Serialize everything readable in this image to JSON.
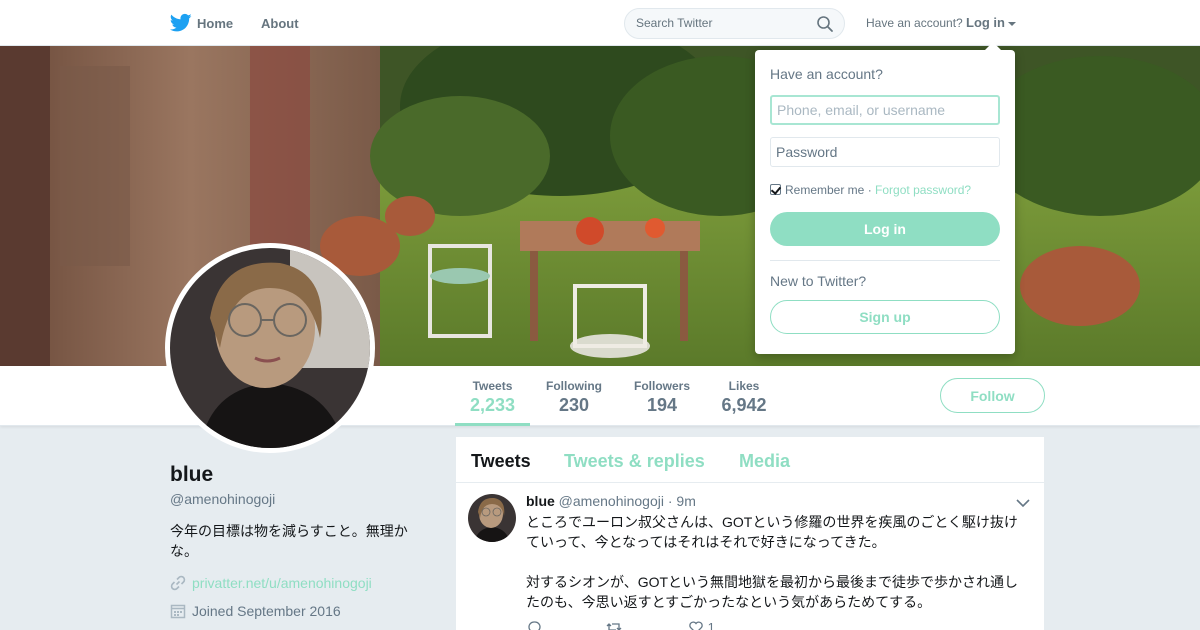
{
  "nav": {
    "logo_icon": "twitter-bird-icon",
    "home_label": "Home",
    "about_label": "About",
    "search_placeholder": "Search Twitter",
    "search_icon": "search-icon",
    "have_account_label": "Have an account?",
    "login_label": "Log in"
  },
  "profile": {
    "name": "blue",
    "handle": "@amenohinogoji",
    "bio": "今年の目標は物を減らすこと。無理かな。",
    "link": "privatter.net/u/amenohinogoji",
    "joined": "Joined September 2016"
  },
  "stats": {
    "tweets_label": "Tweets",
    "tweets_value": "2,233",
    "following_label": "Following",
    "following_value": "230",
    "followers_label": "Followers",
    "followers_value": "194",
    "likes_label": "Likes",
    "likes_value": "6,942"
  },
  "follow_button": "Follow",
  "timeline": {
    "tabs": [
      "Tweets",
      "Tweets & replies",
      "Media"
    ],
    "active_tab": "Tweets"
  },
  "tweet": {
    "name": "blue",
    "handle": "@amenohinogoji",
    "separator": "·",
    "time": "9m",
    "paragraphs": [
      "ところでユーロン叔父さんは、GOTという修羅の世界を疾風のごとく駆け抜けていって、今となってはそれはそれで好きになってきた。",
      "対するシオンが、GOTという無間地獄を最初から最後まで徒歩で歩かされ通したのも、今思い返すとすごかったなという気があらためてする。"
    ],
    "like_count": "1"
  },
  "login_dropdown": {
    "heading": "Have an account?",
    "username_placeholder": "Phone, email, or username",
    "password_placeholder": "Password",
    "remember_label": "Remember me",
    "separator": "·",
    "forgot_label": "Forgot password?",
    "login_button": "Log in",
    "new_label": "New to Twitter?",
    "signup_button": "Sign up"
  },
  "colors": {
    "accent": "#8fdec3",
    "text_secondary": "#657786",
    "background": "#e6ecf0"
  }
}
